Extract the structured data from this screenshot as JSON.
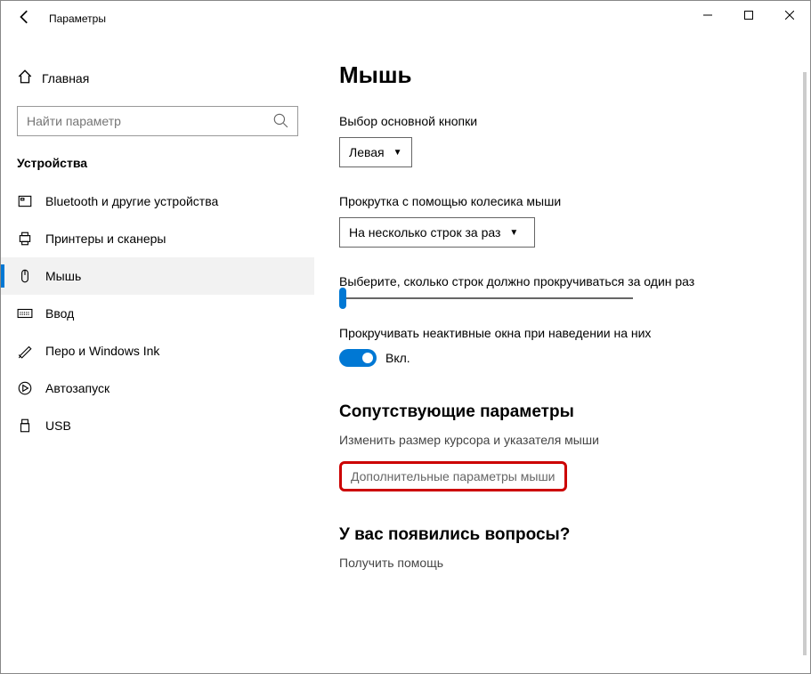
{
  "titlebar": {
    "title": "Параметры"
  },
  "sidebar": {
    "home_label": "Главная",
    "search_placeholder": "Найти параметр",
    "category": "Устройства",
    "items": [
      {
        "id": "bluetooth",
        "label": "Bluetooth и другие устройства"
      },
      {
        "id": "printers",
        "label": "Принтеры и сканеры"
      },
      {
        "id": "mouse",
        "label": "Мышь"
      },
      {
        "id": "typing",
        "label": "Ввод"
      },
      {
        "id": "pen",
        "label": "Перо и Windows Ink"
      },
      {
        "id": "autoplay",
        "label": "Автозапуск"
      },
      {
        "id": "usb",
        "label": "USB"
      }
    ]
  },
  "main": {
    "page_title": "Мышь",
    "primary_button_label": "Выбор основной кнопки",
    "primary_button_value": "Левая",
    "scroll_mode_label": "Прокрутка с помощью колесика мыши",
    "scroll_mode_value": "На несколько строк за раз",
    "lines_label": "Выберите, сколько строк должно прокручиваться за один раз",
    "inactive_label": "Прокручивать неактивные окна при наведении на них",
    "inactive_toggle_text": "Вкл.",
    "related_header": "Сопутствующие параметры",
    "link_cursor_size": "Изменить размер курсора и указателя мыши",
    "link_advanced": "Дополнительные параметры мыши",
    "questions_header": "У вас появились вопросы?",
    "link_help": "Получить помощь"
  }
}
